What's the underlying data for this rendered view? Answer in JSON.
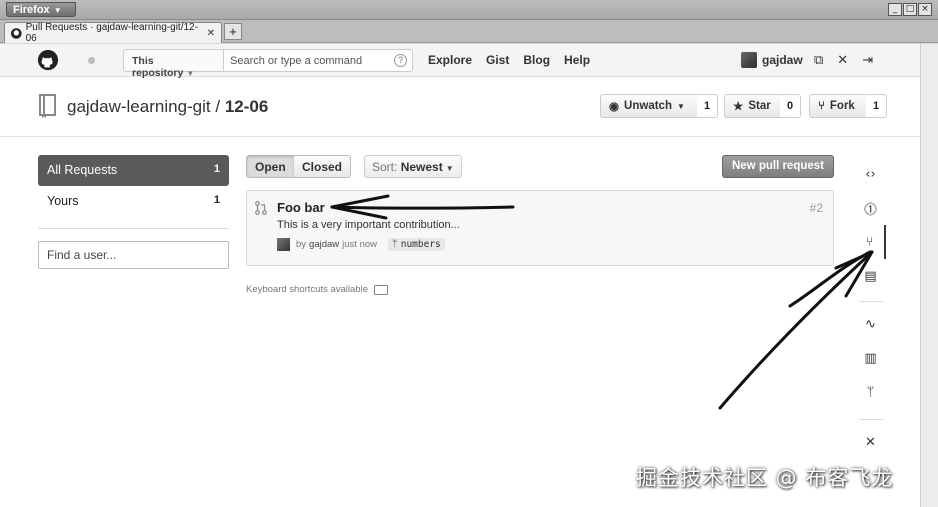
{
  "browser": {
    "menu_label": "Firefox",
    "tab_title": "Pull Requests · gajdaw-learning-git/12-06",
    "window_controls": [
      "_",
      "□",
      "×"
    ]
  },
  "header": {
    "scope_label": "This repository",
    "search_placeholder": "Search or type a command",
    "nav": [
      "Explore",
      "Gist",
      "Blog",
      "Help"
    ],
    "username": "gajdaw"
  },
  "repo": {
    "owner": "gajdaw-learning-git",
    "separator": "/",
    "name": "12-06",
    "unwatch_label": "Unwatch",
    "unwatch_count": "1",
    "star_label": "Star",
    "star_count": "0",
    "fork_label": "Fork",
    "fork_count": "1"
  },
  "sidebar": {
    "items": [
      {
        "label": "All Requests",
        "count": "1"
      },
      {
        "label": "Yours",
        "count": "1"
      }
    ],
    "find_user_placeholder": "Find a user..."
  },
  "filters": {
    "open_label": "Open",
    "closed_label": "Closed",
    "sort_prefix": "Sort:",
    "sort_value": "Newest",
    "new_pr_label": "New pull request"
  },
  "pull_requests": [
    {
      "title": "Foo bar",
      "number": "#2",
      "description": "This is a very important contribution...",
      "by": "by",
      "author": "gajdaw",
      "time": "just now",
      "branch": "numbers"
    }
  ],
  "keyboard_hint": "Keyboard shortcuts available",
  "watermark": "掘金技术社区 @ 布客飞龙",
  "colors": {
    "active_sidebar": "#5a5a5a",
    "page_bg": "#ffffff",
    "chrome_bg": "#bdbdbd"
  }
}
